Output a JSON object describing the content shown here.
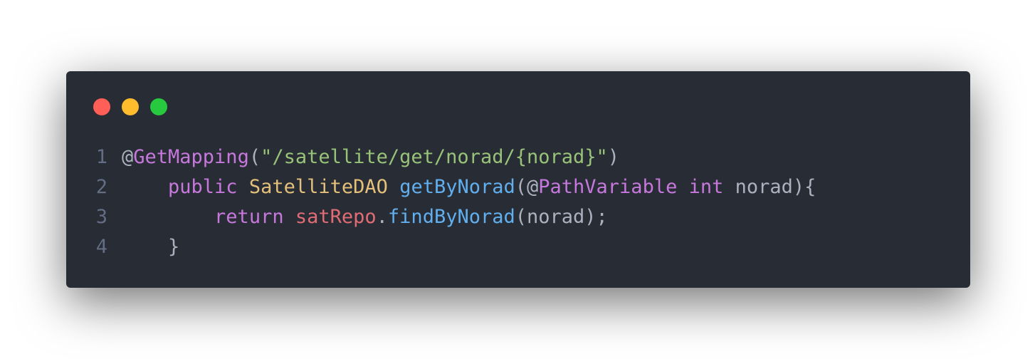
{
  "window": {
    "controls": [
      {
        "name": "close",
        "color": "#ff5f56"
      },
      {
        "name": "minimize",
        "color": "#ffbd2e"
      },
      {
        "name": "maximize",
        "color": "#27c93f"
      }
    ]
  },
  "theme": {
    "background": "#282c34",
    "default": "#abb2bf",
    "keyword": "#c678dd",
    "string": "#98c379",
    "type": "#e5c07b",
    "function": "#61afef",
    "variable": "#e06c75",
    "line_number": "#636d83"
  },
  "code": {
    "lines": [
      {
        "number": "1",
        "tokens": [
          {
            "text": "@",
            "kind": "default"
          },
          {
            "text": "GetMapping",
            "kind": "keyword"
          },
          {
            "text": "(",
            "kind": "default"
          },
          {
            "text": "\"/satellite/get/norad/{norad}\"",
            "kind": "string"
          },
          {
            "text": ")",
            "kind": "default"
          }
        ]
      },
      {
        "number": "2",
        "tokens": [
          {
            "text": "    ",
            "kind": "default"
          },
          {
            "text": "public",
            "kind": "keyword"
          },
          {
            "text": " ",
            "kind": "default"
          },
          {
            "text": "SatelliteDAO",
            "kind": "type"
          },
          {
            "text": " ",
            "kind": "default"
          },
          {
            "text": "getByNorad",
            "kind": "function"
          },
          {
            "text": "(@",
            "kind": "default"
          },
          {
            "text": "PathVariable",
            "kind": "keyword"
          },
          {
            "text": " ",
            "kind": "default"
          },
          {
            "text": "int",
            "kind": "keyword"
          },
          {
            "text": " norad){",
            "kind": "default"
          }
        ]
      },
      {
        "number": "3",
        "tokens": [
          {
            "text": "        ",
            "kind": "default"
          },
          {
            "text": "return",
            "kind": "keyword"
          },
          {
            "text": " ",
            "kind": "default"
          },
          {
            "text": "satRepo",
            "kind": "variable"
          },
          {
            "text": ".",
            "kind": "default"
          },
          {
            "text": "findByNorad",
            "kind": "function"
          },
          {
            "text": "(norad);",
            "kind": "default"
          }
        ]
      },
      {
        "number": "4",
        "tokens": [
          {
            "text": "    ",
            "kind": "default"
          },
          {
            "text": "}",
            "kind": "default"
          }
        ]
      }
    ]
  }
}
